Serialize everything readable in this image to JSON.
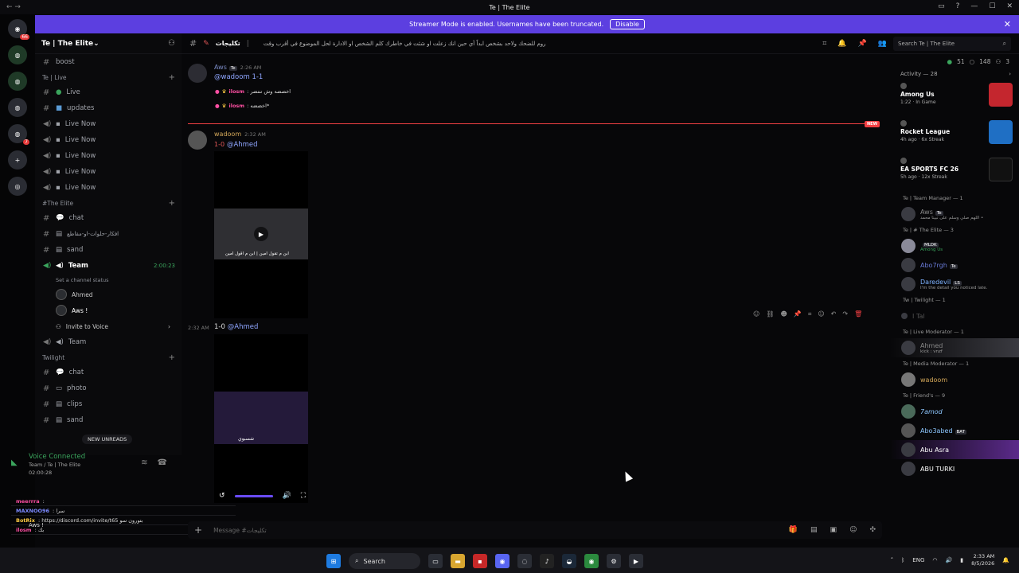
{
  "window": {
    "title": "Te | The Elite"
  },
  "banner": {
    "text": "Streamer Mode is enabled. Usernames have been truncated.",
    "button": "Disable",
    "color": "#5c3fe0"
  },
  "server": {
    "name": "Te | The Elite"
  },
  "channels": {
    "boost": "boost",
    "cat_live": "Te | Live",
    "live": "Live",
    "updates": "updates",
    "live_now": "Live Now",
    "cat_elite": "#The Elite",
    "chat": "chat",
    "arabic_ch": "افكار-حلوات-او-مقاطع",
    "sand": "sand",
    "team": "Team",
    "team_time": "2:00:23",
    "channel_status": "Set a channel status",
    "voice_user1": "Ahmed",
    "voice_user2": "Aws !",
    "invite": "Invite to Voice",
    "team2": "Team",
    "cat_twilight": "Twilight",
    "chat2": "chat",
    "photo": "photo",
    "clips": "clips",
    "sand2": "sand",
    "new_unreads": "NEW UNREADS"
  },
  "voice": {
    "connected": "Voice Connected",
    "sub": "Team / Te | The Elite",
    "time": "02:00:28"
  },
  "overlay": {
    "l1_name": "meerrra",
    "l1_text": ":",
    "l2_name": "MAXNOO96",
    "l2_text": ": سرا",
    "l3_name": "BotRix",
    "l3_text": ": https://discord.com/invite/t65 بتورون سو",
    "l4_name": "ilosm",
    "l4_text": ": بك",
    "aws": "Aws !"
  },
  "topbar": {
    "channel": "تكليجات",
    "topic": "روم للضحك ولاحد بشخص ابداً أي حين انك زعلت او شئت في خاطرك كلم الشخص او الادارة لحل الموضوع في أقرب وقت",
    "search": "Search Te | The Elite"
  },
  "messages": {
    "m1_user": "Aws",
    "m1_tag": "Te",
    "m1_time": "2:26 AM",
    "m1_text": "@wadoom 1-1",
    "r1_name": "ilosm",
    "r1_text": ": اخضضه وش تنتضر",
    "r2_name": "ilosm",
    "r2_text": ": اخضضه*",
    "new": "NEW",
    "m2_user": "wadoom",
    "m2_time": "2:32 AM",
    "m2_pre": "1-0",
    "m2_ment": "@Ahmed",
    "video1_caption": "ابن م تقول امين | ابن م اقول امين",
    "m3_time": "2:32 AM",
    "m3_pre": "1-0",
    "m3_ment": "@Ahmed",
    "video2_caption": "شسبوي"
  },
  "input": {
    "placeholder": "Message #تكليجات"
  },
  "members": {
    "online": "51",
    "offline": "148",
    "other": "3",
    "activity": "Activity — 28",
    "g1": "Among Us",
    "g1_s": "1:22 · In Game",
    "g2": "Rocket League",
    "g2_s": "4h ago · 6x Streak",
    "g3": "EA SPORTS FC 26",
    "g3_s": "5h ago · 12x Streak",
    "role1": "Te | Team Manager — 1",
    "u1": "Aws",
    "u1_tag": "Te",
    "u1_s": "اللهم صلي وسلم على نبينا محمد •",
    "role2": "Te | # The Elite — 3",
    "u2": "MLDK",
    "u2_s": "Among Us",
    "u3": "Abo7rgh",
    "u3_tag": "Te",
    "u4": "Daredevil",
    "u4_tag": "LS",
    "u4_s": "I'm the detail you noticed late.",
    "role3": "Tw | Twilight — 1",
    "u5": "I Tal",
    "role4": "Te | Live Moderator — 1",
    "u6": "Ahmed",
    "u6_s": "kick : vnzf",
    "role5": "Te | Media Moderator — 1",
    "u7": "wadoom",
    "role6": "Te | Friend's — 9",
    "u8": "7amod",
    "u9": "Abo3abed",
    "u9_tag": "BAT",
    "u10": "Abu Asra",
    "u11": "ABU TURKI"
  },
  "taskbar": {
    "search": "Search",
    "lang": "ENG",
    "time": "2:33 AM",
    "date": "8/5/2026"
  }
}
